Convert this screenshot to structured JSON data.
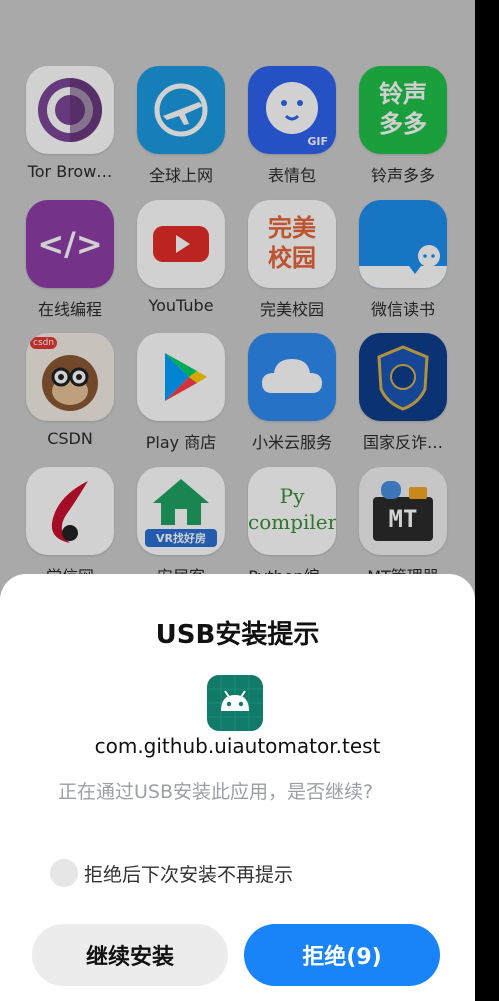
{
  "home_apps": [
    {
      "label": "Tor Brow…"
    },
    {
      "label": "全球上网"
    },
    {
      "label": "表情包",
      "badge": "GIF"
    },
    {
      "label": "铃声多多",
      "icon_text": "铃声\n多多"
    },
    {
      "label": "在线编程",
      "icon_text": "</>"
    },
    {
      "label": "YouTube"
    },
    {
      "label": "完美校园",
      "icon_text": "完美\n校园"
    },
    {
      "label": "微信读书"
    },
    {
      "label": "CSDN",
      "badge": "csdn"
    },
    {
      "label": "Play 商店"
    },
    {
      "label": "小米云服务"
    },
    {
      "label": "国家反诈…"
    },
    {
      "label": "学信网"
    },
    {
      "label": "安居客",
      "icon_text": "VR找好房"
    },
    {
      "label": "Python编…",
      "icon_text": "Py\ncompiler"
    },
    {
      "label": "MT管理器",
      "icon_text": "MT"
    }
  ],
  "dialog": {
    "title": "USB安装提示",
    "package_name": "com.github.uiautomator.test",
    "message": "正在通过USB安装此应用，是否继续?",
    "checkbox_label": "拒绝后下次安装不再提示",
    "continue_label": "继续安装",
    "reject_label": "拒绝(9)"
  },
  "colors": {
    "reject_button": "#1984f7",
    "continue_button": "#ececec",
    "android_icon_bg": "#127a69"
  }
}
